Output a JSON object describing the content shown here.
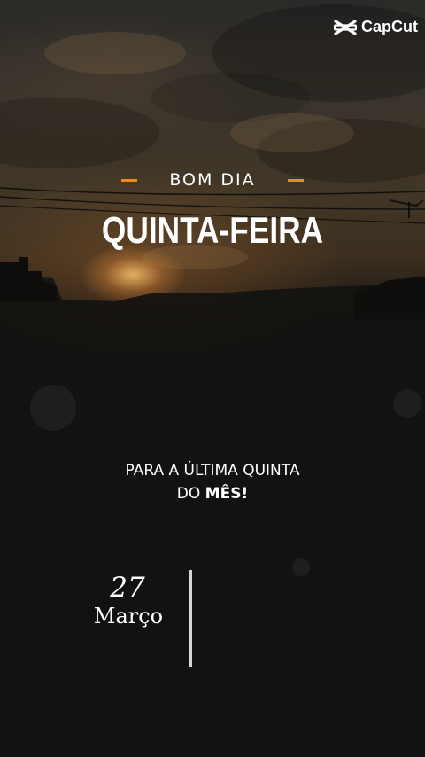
{
  "watermark": {
    "label": "CapCut",
    "icon": "capcut-logo-icon"
  },
  "headline": {
    "greeting": "BOM DIA",
    "day": "QUINTA-FEIRA",
    "accent_color": "#f08a18"
  },
  "message": {
    "line1": "PARA A ÚLTIMA QUINTA",
    "line2_prefix": "DO ",
    "line2_emphasis": "MÊS!"
  },
  "date": {
    "day_number": "27",
    "month": "Março"
  }
}
